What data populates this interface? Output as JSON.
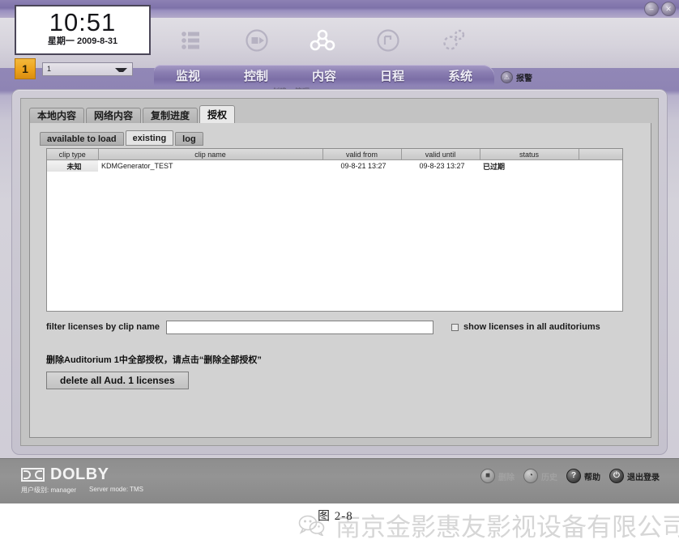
{
  "window": {
    "buttons": [
      {
        "name": "minimize",
        "glyph": "–"
      },
      {
        "name": "close",
        "glyph": "✕"
      }
    ]
  },
  "header": {
    "clock": {
      "time": "10:51",
      "date": "星期一 2009-8-31"
    },
    "auditorium": {
      "badge": "1",
      "selected": "1"
    },
    "nav_icons": [
      {
        "name": "monitor-icon"
      },
      {
        "name": "control-play-icon"
      },
      {
        "name": "content-nodes-icon"
      },
      {
        "name": "schedule-clock-icon"
      },
      {
        "name": "system-gears-icon"
      }
    ],
    "nav_tabs": [
      {
        "label": "监视",
        "name": "nav-monitor"
      },
      {
        "label": "控制",
        "name": "nav-control"
      },
      {
        "label": "内容",
        "name": "nav-content"
      },
      {
        "label": "日程",
        "name": "nav-schedule"
      },
      {
        "label": "系统",
        "name": "nav-system"
      }
    ],
    "nav_sublabels": [
      "创建",
      "管理"
    ],
    "alarm": {
      "label": "报警",
      "icon": "⚠"
    }
  },
  "main": {
    "tabs": [
      {
        "label": "本地内容",
        "name": "tab-local-content",
        "active": false
      },
      {
        "label": "网络内容",
        "name": "tab-network-content",
        "active": false
      },
      {
        "label": "复制进度",
        "name": "tab-copy-progress",
        "active": false
      },
      {
        "label": "授权",
        "name": "tab-licenses",
        "active": true
      }
    ],
    "subtabs": [
      {
        "label": "available to load",
        "name": "subtab-available-to-load",
        "active": false
      },
      {
        "label": "existing",
        "name": "subtab-existing",
        "active": true
      },
      {
        "label": "log",
        "name": "subtab-log",
        "active": false
      }
    ],
    "table": {
      "columns": [
        "clip type",
        "clip name",
        "valid from",
        "valid until",
        "status",
        ""
      ],
      "rows": [
        {
          "clip_type": "未知",
          "clip_name": "KDMGenerator_TEST",
          "valid_from": "09-8-21 13:27",
          "valid_until": "09-8-23 13:27",
          "status": "已过期"
        }
      ]
    },
    "filter": {
      "label": "filter licenses by clip name",
      "value": "",
      "placeholder": "",
      "checkbox_label": "show licenses in all auditoriums",
      "checked": false
    },
    "delete_section": {
      "note": "删除Auditorium 1中全部授权，请点击“删除全部授权”",
      "button_label": "delete all Aud. 1 licenses"
    }
  },
  "footer": {
    "brand": "DOLBY",
    "user_level": "用户级别: manager",
    "server_mode": "Server mode: TMS",
    "buttons": [
      {
        "label": "删除",
        "icon": "■",
        "name": "delete-button",
        "enabled": false
      },
      {
        "label": "历史",
        "icon": "◔",
        "name": "history-button",
        "enabled": false
      },
      {
        "label": "帮助",
        "icon": "?",
        "name": "help-button",
        "enabled": true
      },
      {
        "label": "退出登录",
        "icon": "⏻",
        "name": "logout-button",
        "enabled": true
      }
    ]
  },
  "watermark": {
    "company": "南京金影惠友影视设备有限公司",
    "figure_label": "图 2-8"
  }
}
